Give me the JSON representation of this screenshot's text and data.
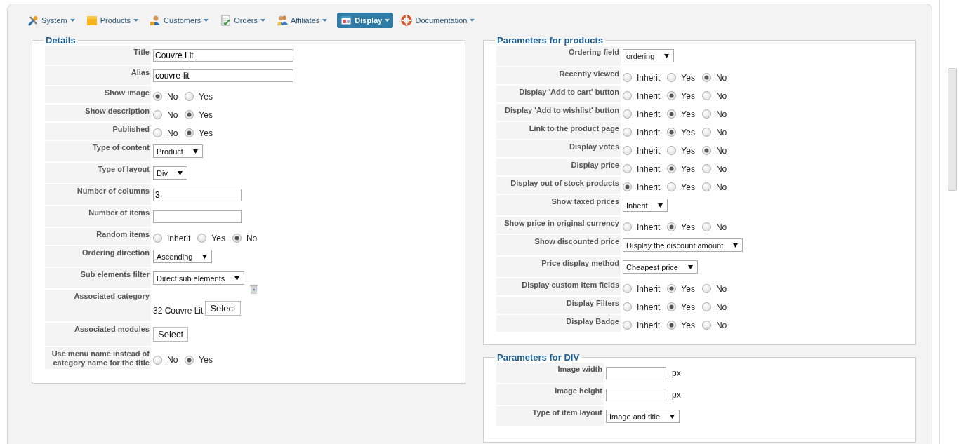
{
  "menu": [
    {
      "label": "System",
      "selected": false
    },
    {
      "label": "Products",
      "selected": false
    },
    {
      "label": "Customers",
      "selected": false
    },
    {
      "label": "Orders",
      "selected": false
    },
    {
      "label": "Affiliates",
      "selected": false
    },
    {
      "label": "Display",
      "selected": true
    },
    {
      "label": "Documentation",
      "selected": false
    }
  ],
  "details": {
    "legend": "Details",
    "rows": [
      {
        "label": "Title",
        "kind": "text",
        "value": "Couvre Lit"
      },
      {
        "label": "Alias",
        "kind": "text",
        "value": "couvre-lit"
      },
      {
        "label": "Show image",
        "kind": "radio",
        "options": [
          {
            "label": "No",
            "selected": true
          },
          {
            "label": "Yes",
            "selected": false
          }
        ]
      },
      {
        "label": "Show description",
        "kind": "radio",
        "options": [
          {
            "label": "No",
            "selected": false
          },
          {
            "label": "Yes",
            "selected": true
          }
        ]
      },
      {
        "label": "Published",
        "kind": "radio",
        "options": [
          {
            "label": "No",
            "selected": false
          },
          {
            "label": "Yes",
            "selected": true
          }
        ]
      },
      {
        "label": "Type of content",
        "kind": "select",
        "value": "Product"
      },
      {
        "label": "Type of layout",
        "kind": "select",
        "value": "Div"
      },
      {
        "label": "Number of columns",
        "kind": "number",
        "value": "3"
      },
      {
        "label": "Number of items",
        "kind": "number"
      },
      {
        "label": "Random items",
        "kind": "radio",
        "options": [
          {
            "label": "Inherit",
            "selected": false
          },
          {
            "label": "Yes",
            "selected": false
          },
          {
            "label": "No",
            "selected": true
          }
        ]
      },
      {
        "label": "Ordering direction",
        "kind": "select",
        "value": "Ascending"
      },
      {
        "label": "Sub elements filter",
        "kind": "select",
        "value": "Direct sub elements"
      },
      {
        "label": "Associated category",
        "kind": "category",
        "value": "32 Couvre Lit",
        "button": "Select"
      },
      {
        "label": "Associated modules",
        "kind": "button",
        "button": "Select"
      },
      {
        "label": "Use menu name instead of category name for the title",
        "kind": "radio",
        "options": [
          {
            "label": "No",
            "selected": false
          },
          {
            "label": "Yes",
            "selected": true
          }
        ]
      }
    ]
  },
  "products": {
    "legend": "Parameters for products",
    "rows": [
      {
        "label": "Ordering field",
        "kind": "select",
        "value": "ordering"
      },
      {
        "label": "Recently viewed",
        "kind": "radio",
        "options": [
          {
            "label": "Inherit",
            "selected": false
          },
          {
            "label": "Yes",
            "selected": false
          },
          {
            "label": "No",
            "selected": true
          }
        ]
      },
      {
        "label": "Display 'Add to cart' button",
        "kind": "radio",
        "options": [
          {
            "label": "Inherit",
            "selected": false
          },
          {
            "label": "Yes",
            "selected": true
          },
          {
            "label": "No",
            "selected": false
          }
        ]
      },
      {
        "label": "Display 'Add to wishlist' button",
        "kind": "radio",
        "options": [
          {
            "label": "Inherit",
            "selected": false
          },
          {
            "label": "Yes",
            "selected": true
          },
          {
            "label": "No",
            "selected": false
          }
        ]
      },
      {
        "label": "Link to the product page",
        "kind": "radio",
        "options": [
          {
            "label": "Inherit",
            "selected": false
          },
          {
            "label": "Yes",
            "selected": true
          },
          {
            "label": "No",
            "selected": false
          }
        ]
      },
      {
        "label": "Display votes",
        "kind": "radio",
        "options": [
          {
            "label": "Inherit",
            "selected": false
          },
          {
            "label": "Yes",
            "selected": false
          },
          {
            "label": "No",
            "selected": true
          }
        ]
      },
      {
        "label": "Display price",
        "kind": "radio",
        "options": [
          {
            "label": "Inherit",
            "selected": false
          },
          {
            "label": "Yes",
            "selected": true
          },
          {
            "label": "No",
            "selected": false
          }
        ]
      },
      {
        "label": "Display out of stock products",
        "kind": "radio",
        "options": [
          {
            "label": "Inherit",
            "selected": true
          },
          {
            "label": "Yes",
            "selected": false
          },
          {
            "label": "No",
            "selected": false
          }
        ]
      },
      {
        "label": "Show taxed prices",
        "kind": "select",
        "value": "Inherit"
      },
      {
        "label": "Show price in original currency",
        "kind": "radio",
        "options": [
          {
            "label": "Inherit",
            "selected": false
          },
          {
            "label": "Yes",
            "selected": true
          },
          {
            "label": "No",
            "selected": false
          }
        ]
      },
      {
        "label": "Show discounted price",
        "kind": "select",
        "value": "Display the discount amount"
      },
      {
        "label": "Price display method",
        "kind": "select",
        "value": "Cheapest price"
      },
      {
        "label": "Display custom item fields",
        "kind": "radio",
        "options": [
          {
            "label": "Inherit",
            "selected": false
          },
          {
            "label": "Yes",
            "selected": true
          },
          {
            "label": "No",
            "selected": false
          }
        ]
      },
      {
        "label": "Display Filters",
        "kind": "radio",
        "options": [
          {
            "label": "Inherit",
            "selected": false
          },
          {
            "label": "Yes",
            "selected": true
          },
          {
            "label": "No",
            "selected": false
          }
        ]
      },
      {
        "label": "Display Badge",
        "kind": "radio",
        "options": [
          {
            "label": "Inherit",
            "selected": false
          },
          {
            "label": "Yes",
            "selected": true
          },
          {
            "label": "No",
            "selected": false
          }
        ]
      }
    ]
  },
  "div": {
    "legend": "Parameters for DIV",
    "rows": [
      {
        "label": "Image width",
        "kind": "number",
        "unit": "px"
      },
      {
        "label": "Image height",
        "kind": "number",
        "unit": "px"
      },
      {
        "label": "Type of item layout",
        "kind": "select",
        "value": "Image and title"
      }
    ]
  }
}
